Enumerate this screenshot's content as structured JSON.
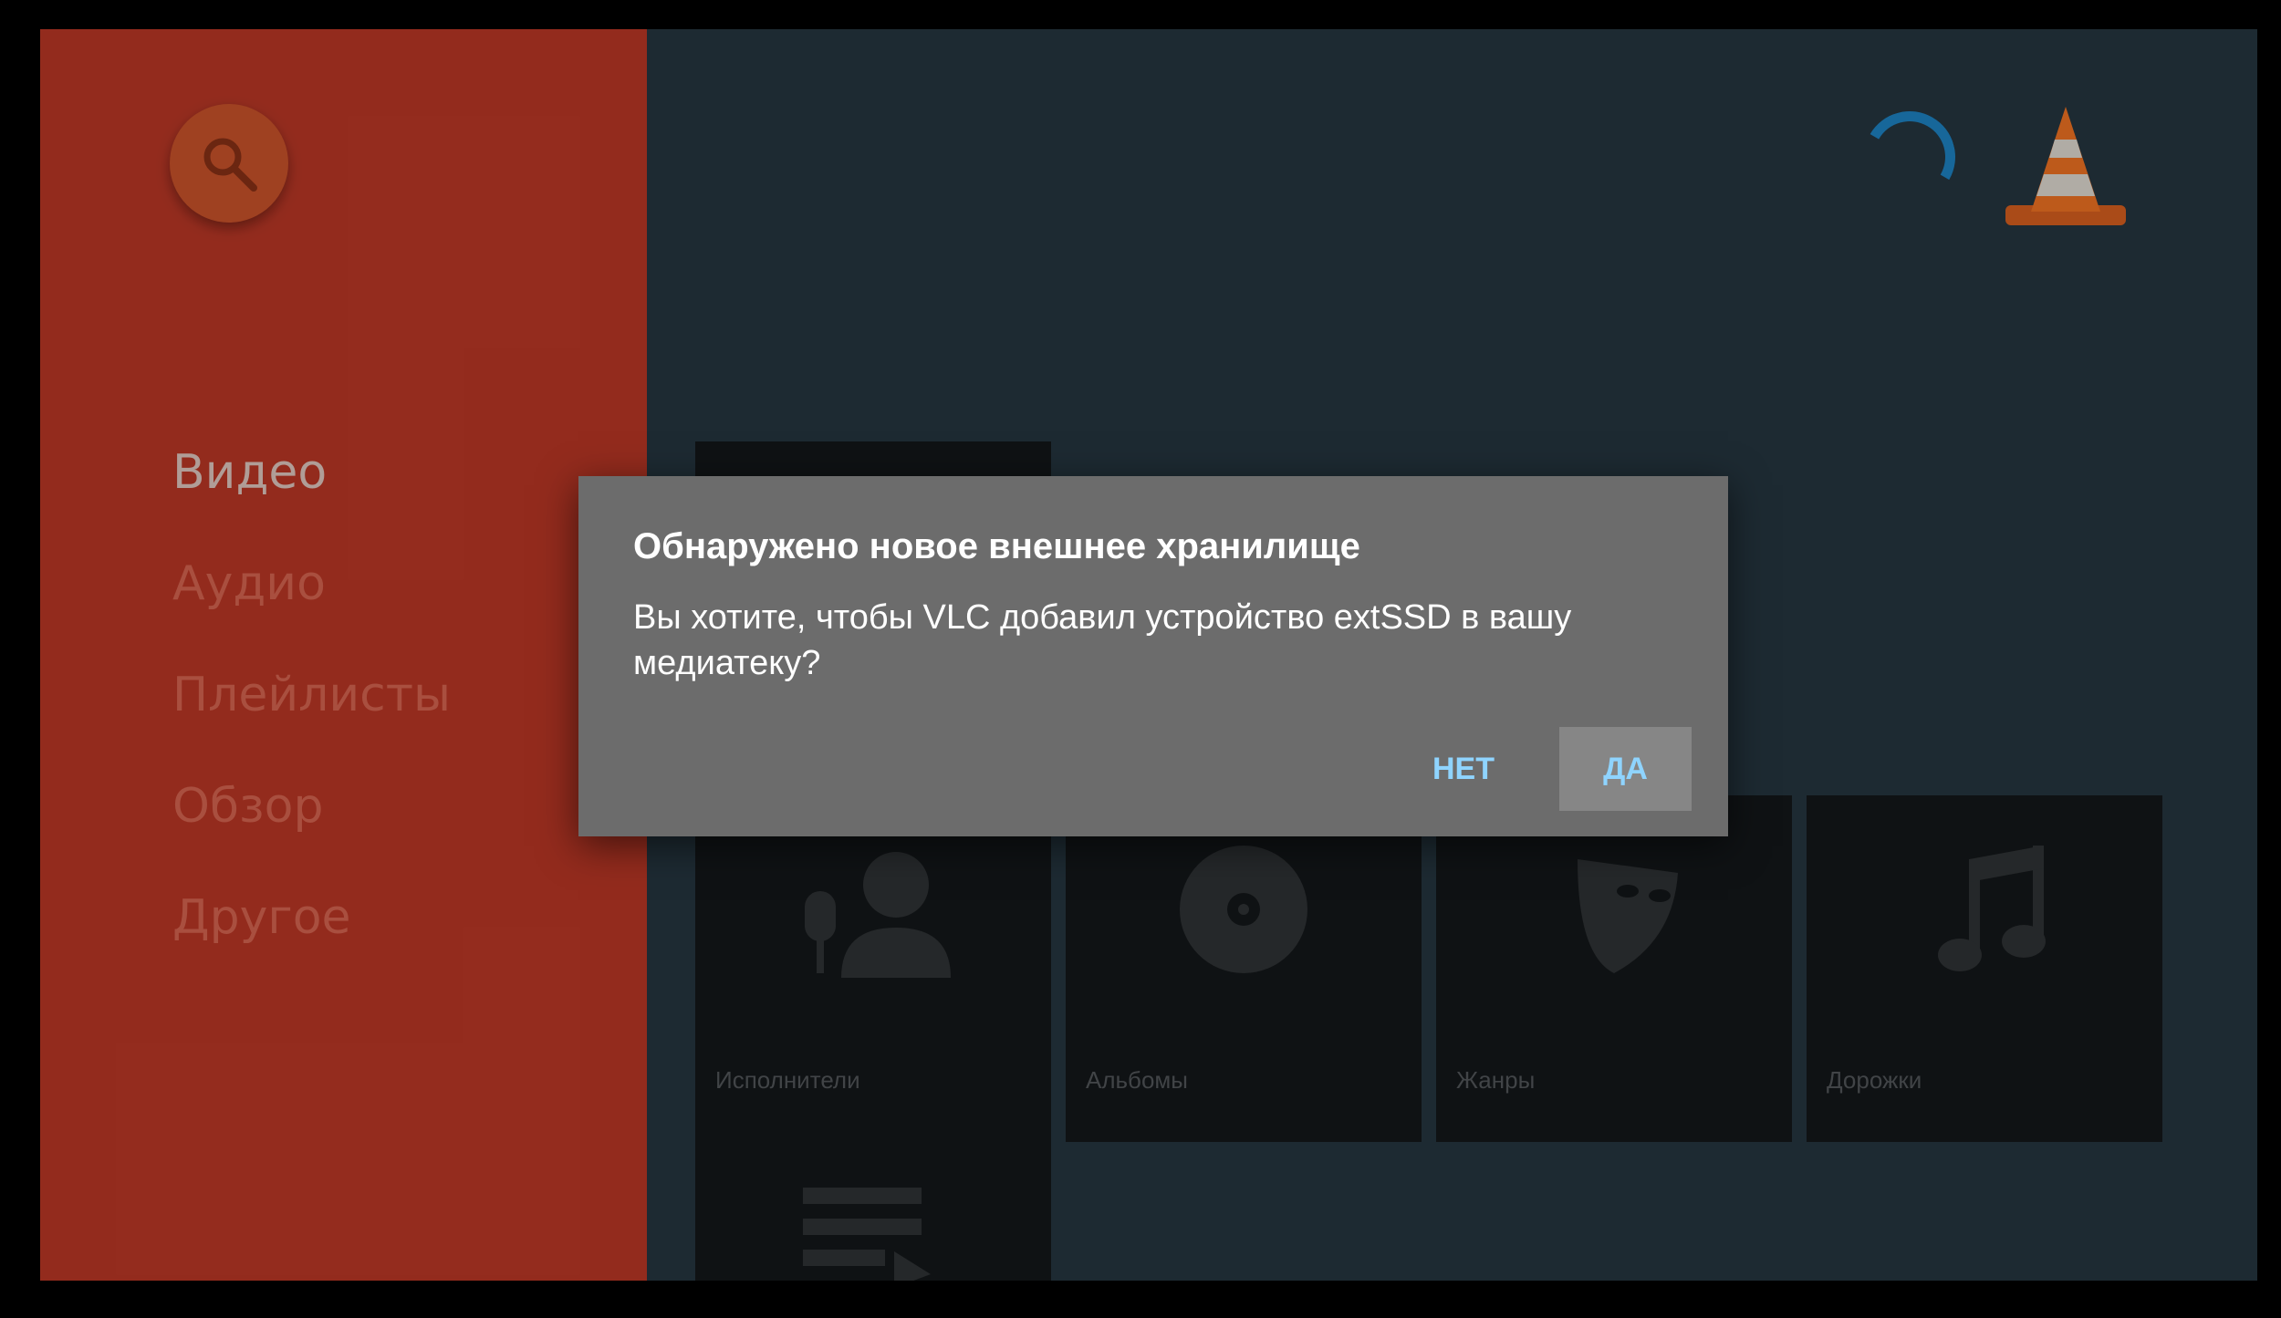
{
  "sidebar": {
    "search_icon": "search-icon",
    "items": [
      {
        "label": "Видео",
        "active": true
      },
      {
        "label": "Аудио",
        "active": false
      },
      {
        "label": "Плейлисты",
        "active": false
      },
      {
        "label": "Обзор",
        "active": false
      },
      {
        "label": "Другое",
        "active": false
      }
    ]
  },
  "header": {
    "loading_icon": "loading-spinner-icon",
    "logo": "vlc-cone-logo"
  },
  "tiles": [
    {
      "label": "Исполнители",
      "icon": "artist-icon"
    },
    {
      "label": "Альбомы",
      "icon": "album-icon"
    },
    {
      "label": "Жанры",
      "icon": "genre-mask-icon"
    },
    {
      "label": "Дорожки",
      "icon": "music-note-icon"
    }
  ],
  "dialog": {
    "title": "Обнаружено новое внешнее хранилище",
    "message": "Вы хотите, чтобы VLC добавил устройство extSSD в вашу медиатеку?",
    "no_label": "НЕТ",
    "yes_label": "ДА"
  },
  "colors": {
    "accent_sidebar": "#a83222",
    "background": "#213039",
    "dialog": "#6c6c6c",
    "button_text": "#8fd4ff"
  }
}
